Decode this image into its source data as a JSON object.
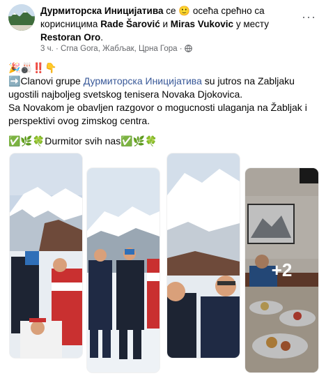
{
  "header": {
    "page_name": "Дурмиторска Иницијатива",
    "text_1": " се ",
    "feeling_emoji": "🙂",
    "text_2": " осећа срећно са корисницима ",
    "person_1": "Rade Šarović",
    "text_3": " и ",
    "person_2": "Miras Vukovic",
    "text_4": " у месту ",
    "place": "Restoran Oro",
    "text_5": "."
  },
  "meta": {
    "time": "3 ч.",
    "separator": " · ",
    "location": "Crna Gora, Жабљак, Црна Гора",
    "separator2": " · ",
    "audience_icon": "globe-icon"
  },
  "more_label": "···",
  "post": {
    "emoji_line": "🎉🎳‼️👇",
    "arrow_emoji": "➡️",
    "line1_a": "Clanovi grupe ",
    "line1_link": "Дурмиторска Иницијатива",
    "line1_b": " su jutros na Zabljaku ugostili najboljeg svetskog tenisera Novaka Djokovica.",
    "line2": "Sa Novakom je obavljen razgovor o mogucnosti ulaganja na Žabljak i perspektivi ovog zimskog centra.",
    "line3_emoji_a": "✅🌿🍀",
    "line3_text": "Durmitor svih nas",
    "line3_emoji_b": "✅🌿🍀"
  },
  "photos": {
    "more_count": "+2"
  },
  "colors": {
    "link": "#385898",
    "meta": "#65676b"
  }
}
